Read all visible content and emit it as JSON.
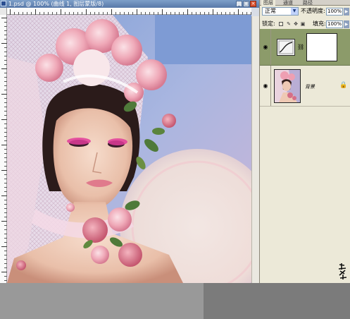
{
  "document": {
    "title": "1.psd @ 100% (曲线 1, 图层蒙版/8)",
    "buttons": {
      "minimize": "_",
      "maximize": "□",
      "close": "×"
    }
  },
  "layers_panel": {
    "tabs": [
      "图层",
      "通道",
      "路径"
    ],
    "active_tab": "图层",
    "blend_mode": "正常",
    "opacity_label": "不透明度:",
    "opacity_value": "100%",
    "lock_label": "锁定:",
    "fill_label": "填充:",
    "fill_value": "100%",
    "layers": [
      {
        "name": "",
        "type": "adjustment-curves",
        "has_mask": true,
        "visible": true,
        "selected": true
      },
      {
        "name": "背景",
        "type": "image",
        "visible": true,
        "locked": true,
        "selected": false
      }
    ]
  },
  "icons": {
    "visibility": "eye-icon",
    "lock": "lock-icon",
    "curves": "curves-icon",
    "link": "chain-link-icon",
    "dropdown": "chevron-down-icon",
    "flyout": "flyout-arrow-icon"
  },
  "colors": {
    "title_bar": "#5878a8",
    "selected_layer": "#8c9b6a",
    "panel_bg": "#ece9d8",
    "canvas_backdrop": "#c3b9dc"
  }
}
